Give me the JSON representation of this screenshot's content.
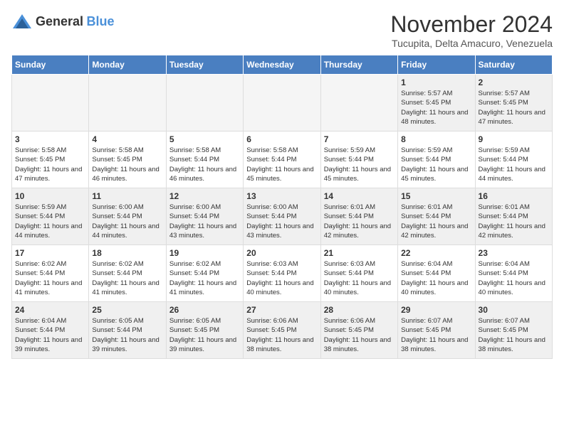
{
  "logo": {
    "general": "General",
    "blue": "Blue"
  },
  "title": "November 2024",
  "location": "Tucupita, Delta Amacuro, Venezuela",
  "days_of_week": [
    "Sunday",
    "Monday",
    "Tuesday",
    "Wednesday",
    "Thursday",
    "Friday",
    "Saturday"
  ],
  "weeks": [
    [
      {
        "day": "",
        "empty": true
      },
      {
        "day": "",
        "empty": true
      },
      {
        "day": "",
        "empty": true
      },
      {
        "day": "",
        "empty": true
      },
      {
        "day": "",
        "empty": true
      },
      {
        "day": "1",
        "sunrise": "Sunrise: 5:57 AM",
        "sunset": "Sunset: 5:45 PM",
        "daylight": "Daylight: 11 hours and 48 minutes."
      },
      {
        "day": "2",
        "sunrise": "Sunrise: 5:57 AM",
        "sunset": "Sunset: 5:45 PM",
        "daylight": "Daylight: 11 hours and 47 minutes."
      }
    ],
    [
      {
        "day": "3",
        "sunrise": "Sunrise: 5:58 AM",
        "sunset": "Sunset: 5:45 PM",
        "daylight": "Daylight: 11 hours and 47 minutes."
      },
      {
        "day": "4",
        "sunrise": "Sunrise: 5:58 AM",
        "sunset": "Sunset: 5:45 PM",
        "daylight": "Daylight: 11 hours and 46 minutes."
      },
      {
        "day": "5",
        "sunrise": "Sunrise: 5:58 AM",
        "sunset": "Sunset: 5:44 PM",
        "daylight": "Daylight: 11 hours and 46 minutes."
      },
      {
        "day": "6",
        "sunrise": "Sunrise: 5:58 AM",
        "sunset": "Sunset: 5:44 PM",
        "daylight": "Daylight: 11 hours and 45 minutes."
      },
      {
        "day": "7",
        "sunrise": "Sunrise: 5:59 AM",
        "sunset": "Sunset: 5:44 PM",
        "daylight": "Daylight: 11 hours and 45 minutes."
      },
      {
        "day": "8",
        "sunrise": "Sunrise: 5:59 AM",
        "sunset": "Sunset: 5:44 PM",
        "daylight": "Daylight: 11 hours and 45 minutes."
      },
      {
        "day": "9",
        "sunrise": "Sunrise: 5:59 AM",
        "sunset": "Sunset: 5:44 PM",
        "daylight": "Daylight: 11 hours and 44 minutes."
      }
    ],
    [
      {
        "day": "10",
        "sunrise": "Sunrise: 5:59 AM",
        "sunset": "Sunset: 5:44 PM",
        "daylight": "Daylight: 11 hours and 44 minutes."
      },
      {
        "day": "11",
        "sunrise": "Sunrise: 6:00 AM",
        "sunset": "Sunset: 5:44 PM",
        "daylight": "Daylight: 11 hours and 44 minutes."
      },
      {
        "day": "12",
        "sunrise": "Sunrise: 6:00 AM",
        "sunset": "Sunset: 5:44 PM",
        "daylight": "Daylight: 11 hours and 43 minutes."
      },
      {
        "day": "13",
        "sunrise": "Sunrise: 6:00 AM",
        "sunset": "Sunset: 5:44 PM",
        "daylight": "Daylight: 11 hours and 43 minutes."
      },
      {
        "day": "14",
        "sunrise": "Sunrise: 6:01 AM",
        "sunset": "Sunset: 5:44 PM",
        "daylight": "Daylight: 11 hours and 42 minutes."
      },
      {
        "day": "15",
        "sunrise": "Sunrise: 6:01 AM",
        "sunset": "Sunset: 5:44 PM",
        "daylight": "Daylight: 11 hours and 42 minutes."
      },
      {
        "day": "16",
        "sunrise": "Sunrise: 6:01 AM",
        "sunset": "Sunset: 5:44 PM",
        "daylight": "Daylight: 11 hours and 42 minutes."
      }
    ],
    [
      {
        "day": "17",
        "sunrise": "Sunrise: 6:02 AM",
        "sunset": "Sunset: 5:44 PM",
        "daylight": "Daylight: 11 hours and 41 minutes."
      },
      {
        "day": "18",
        "sunrise": "Sunrise: 6:02 AM",
        "sunset": "Sunset: 5:44 PM",
        "daylight": "Daylight: 11 hours and 41 minutes."
      },
      {
        "day": "19",
        "sunrise": "Sunrise: 6:02 AM",
        "sunset": "Sunset: 5:44 PM",
        "daylight": "Daylight: 11 hours and 41 minutes."
      },
      {
        "day": "20",
        "sunrise": "Sunrise: 6:03 AM",
        "sunset": "Sunset: 5:44 PM",
        "daylight": "Daylight: 11 hours and 40 minutes."
      },
      {
        "day": "21",
        "sunrise": "Sunrise: 6:03 AM",
        "sunset": "Sunset: 5:44 PM",
        "daylight": "Daylight: 11 hours and 40 minutes."
      },
      {
        "day": "22",
        "sunrise": "Sunrise: 6:04 AM",
        "sunset": "Sunset: 5:44 PM",
        "daylight": "Daylight: 11 hours and 40 minutes."
      },
      {
        "day": "23",
        "sunrise": "Sunrise: 6:04 AM",
        "sunset": "Sunset: 5:44 PM",
        "daylight": "Daylight: 11 hours and 40 minutes."
      }
    ],
    [
      {
        "day": "24",
        "sunrise": "Sunrise: 6:04 AM",
        "sunset": "Sunset: 5:44 PM",
        "daylight": "Daylight: 11 hours and 39 minutes."
      },
      {
        "day": "25",
        "sunrise": "Sunrise: 6:05 AM",
        "sunset": "Sunset: 5:44 PM",
        "daylight": "Daylight: 11 hours and 39 minutes."
      },
      {
        "day": "26",
        "sunrise": "Sunrise: 6:05 AM",
        "sunset": "Sunset: 5:45 PM",
        "daylight": "Daylight: 11 hours and 39 minutes."
      },
      {
        "day": "27",
        "sunrise": "Sunrise: 6:06 AM",
        "sunset": "Sunset: 5:45 PM",
        "daylight": "Daylight: 11 hours and 38 minutes."
      },
      {
        "day": "28",
        "sunrise": "Sunrise: 6:06 AM",
        "sunset": "Sunset: 5:45 PM",
        "daylight": "Daylight: 11 hours and 38 minutes."
      },
      {
        "day": "29",
        "sunrise": "Sunrise: 6:07 AM",
        "sunset": "Sunset: 5:45 PM",
        "daylight": "Daylight: 11 hours and 38 minutes."
      },
      {
        "day": "30",
        "sunrise": "Sunrise: 6:07 AM",
        "sunset": "Sunset: 5:45 PM",
        "daylight": "Daylight: 11 hours and 38 minutes."
      }
    ]
  ]
}
